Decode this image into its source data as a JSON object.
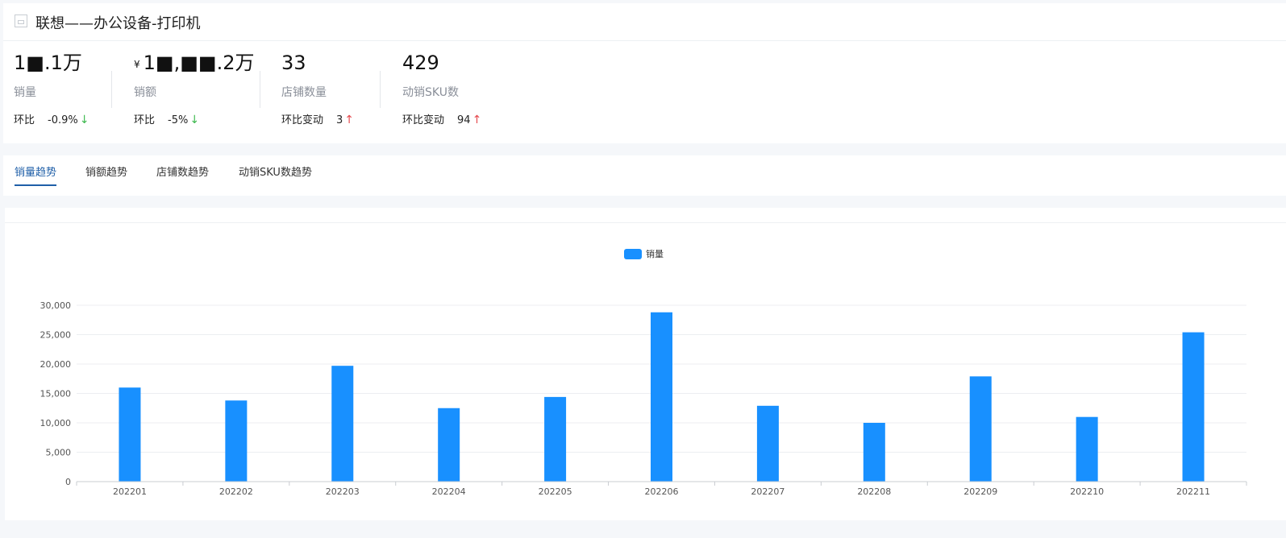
{
  "page": {
    "title": "联想——办公设备-打印机"
  },
  "metrics": [
    {
      "value": "1■.1万",
      "currency": "",
      "label": "销量",
      "compare_label": "环比",
      "compare_value": "-0.9%",
      "trend": "down"
    },
    {
      "value": "1■,■■.2万",
      "currency": "¥",
      "label": "销额",
      "compare_label": "环比",
      "compare_value": "-5%",
      "trend": "down"
    },
    {
      "value": "33",
      "currency": "",
      "label": "店铺数量",
      "compare_label": "环比变动",
      "compare_value": "3",
      "trend": "up"
    },
    {
      "value": "429",
      "currency": "",
      "label": "动销SKU数",
      "compare_label": "环比变动",
      "compare_value": "94",
      "trend": "up"
    }
  ],
  "tabs": [
    {
      "label": "销量趋势",
      "active": true
    },
    {
      "label": "销额趋势",
      "active": false
    },
    {
      "label": "店铺数趋势",
      "active": false
    },
    {
      "label": "动销SKU数趋势",
      "active": false
    }
  ],
  "colors": {
    "bar": "#1890ff",
    "tab_active": "#1f5fa8",
    "trend_down": "#3fb950",
    "trend_up": "#e5484d"
  },
  "chart_data": {
    "type": "bar",
    "categories": [
      "202201",
      "202202",
      "202203",
      "202204",
      "202205",
      "202206",
      "202207",
      "202208",
      "202209",
      "202210",
      "202211"
    ],
    "series": [
      {
        "name": "销量",
        "values": [
          16000,
          13800,
          19700,
          12500,
          14400,
          28800,
          12900,
          10000,
          17900,
          11000,
          25400
        ]
      }
    ],
    "ylim": [
      0,
      30000
    ],
    "yticks": [
      0,
      5000,
      10000,
      15000,
      20000,
      25000,
      30000
    ],
    "ytick_labels": [
      "0",
      "5,000",
      "10,000",
      "15,000",
      "20,000",
      "25,000",
      "30,000"
    ],
    "legend": "top-center",
    "grid": true
  }
}
